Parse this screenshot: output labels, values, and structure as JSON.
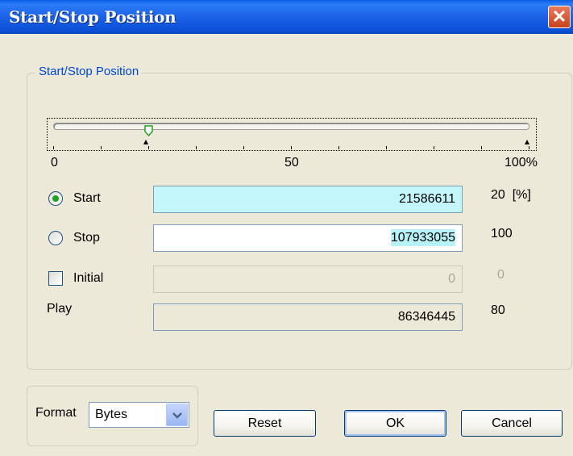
{
  "window": {
    "title": "Start/Stop Position",
    "close_glyph": "✕"
  },
  "group": {
    "label": "Start/Stop Position"
  },
  "slider": {
    "scale_labels": {
      "min": "0",
      "mid": "50",
      "max": "100%"
    },
    "start_percent": 20,
    "stop_percent": 100
  },
  "rows": {
    "start": {
      "label": "Start",
      "value": "21586611",
      "percent": "20",
      "unit": "[%]",
      "selected": true
    },
    "stop": {
      "label": "Stop",
      "value": "107933055",
      "percent": "100",
      "selected": false
    },
    "initial": {
      "label": "Initial",
      "value": "0",
      "percent": "0",
      "checked": false
    },
    "play": {
      "label": "Play",
      "value": "86346445",
      "percent": "80"
    }
  },
  "format": {
    "label": "Format",
    "selected": "Bytes"
  },
  "buttons": {
    "reset": "Reset",
    "ok": "OK",
    "cancel": "Cancel"
  },
  "colors": {
    "titlebar": "#1b62e6",
    "start_field_bg": "#c2f6fb",
    "selection_bg": "#b6f2f7",
    "group_label": "#0046d5"
  }
}
